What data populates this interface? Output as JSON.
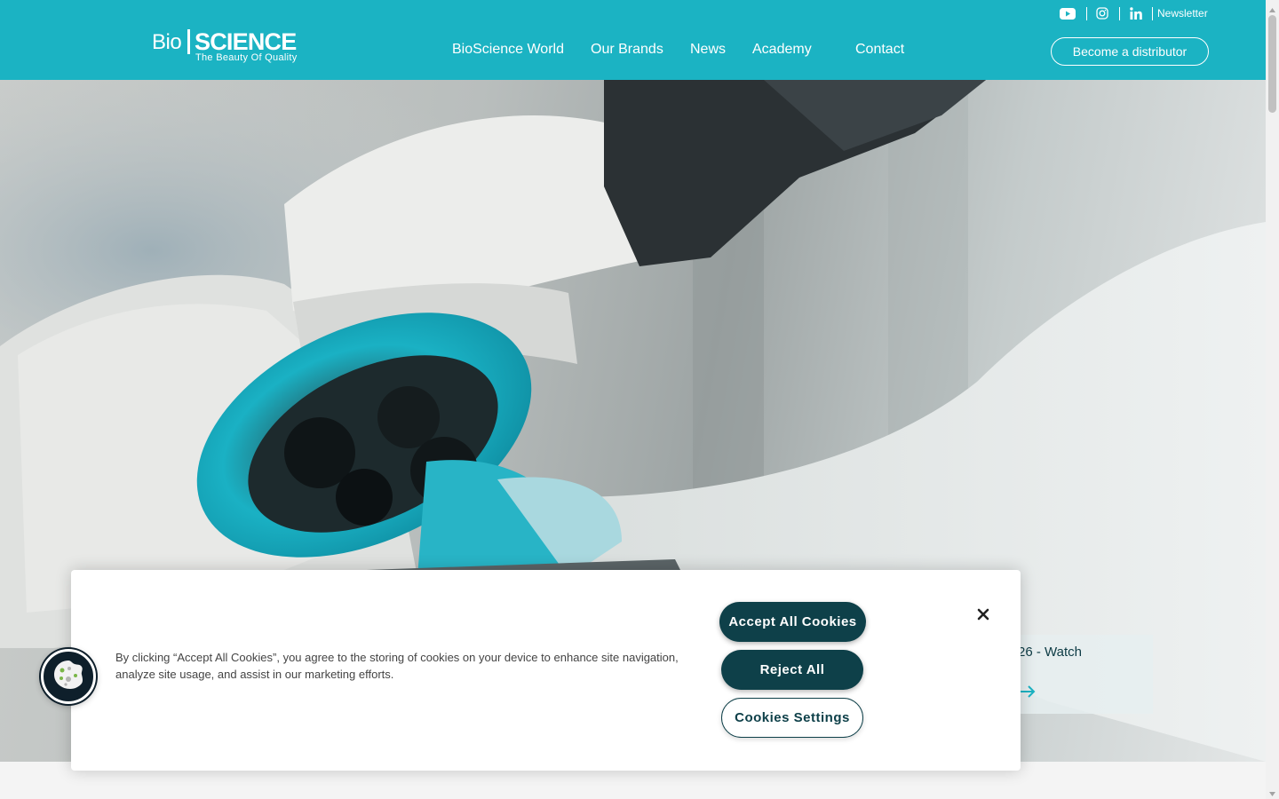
{
  "brand": {
    "logo_left": "Bio",
    "logo_right": "SCIENCE",
    "tagline": "The Beauty Of Quality"
  },
  "nav": {
    "items": [
      {
        "label": "BioScience World"
      },
      {
        "label": "Our Brands"
      },
      {
        "label": "News"
      },
      {
        "label": "Academy"
      },
      {
        "label": "Contact"
      }
    ]
  },
  "top_links": {
    "icons": [
      "youtube-icon",
      "instagram-icon",
      "linkedin-icon"
    ],
    "newsletter": "Newsletter"
  },
  "header_cta": {
    "label": "Become a distributor"
  },
  "hero": {
    "card_text": "26 - Watch"
  },
  "cookie_banner": {
    "text": "By clicking “Accept All Cookies”, you agree to the storing of cookies on your device to enhance site navigation, analyze site usage, and assist in our marketing efforts.",
    "accept_label": "Accept All Cookies",
    "reject_label": "Reject All",
    "settings_label": "Cookies Settings"
  },
  "colors": {
    "header_bg": "#1bb3c3",
    "button_dark": "#0e4049",
    "accent_teal": "#1bb3c3"
  }
}
